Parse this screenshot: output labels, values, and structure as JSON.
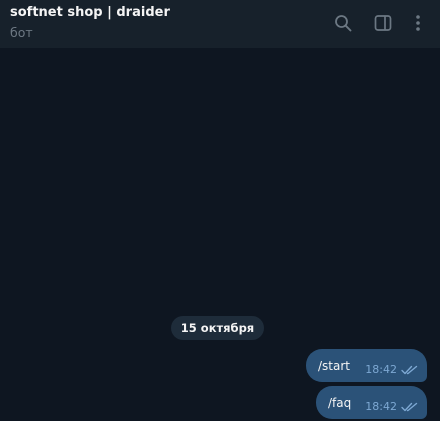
{
  "header": {
    "title": "softnet shop | draider",
    "subtitle": "бот",
    "icons": [
      "search-icon",
      "sidebar-toggle-icon",
      "more-vertical-icon"
    ]
  },
  "chat": {
    "date_separator": "15 октября",
    "messages": [
      {
        "text": "/start",
        "time": "18:42",
        "status": "read"
      },
      {
        "text": "/faq",
        "time": "18:42",
        "status": "read"
      }
    ]
  },
  "colors": {
    "background": "#0e1621",
    "header": "#17212b",
    "outgoing_bubble": "#2b5278",
    "meta_text": "#7da8d3",
    "subtitle_text": "#6d7883",
    "icon": "#6c7883"
  }
}
